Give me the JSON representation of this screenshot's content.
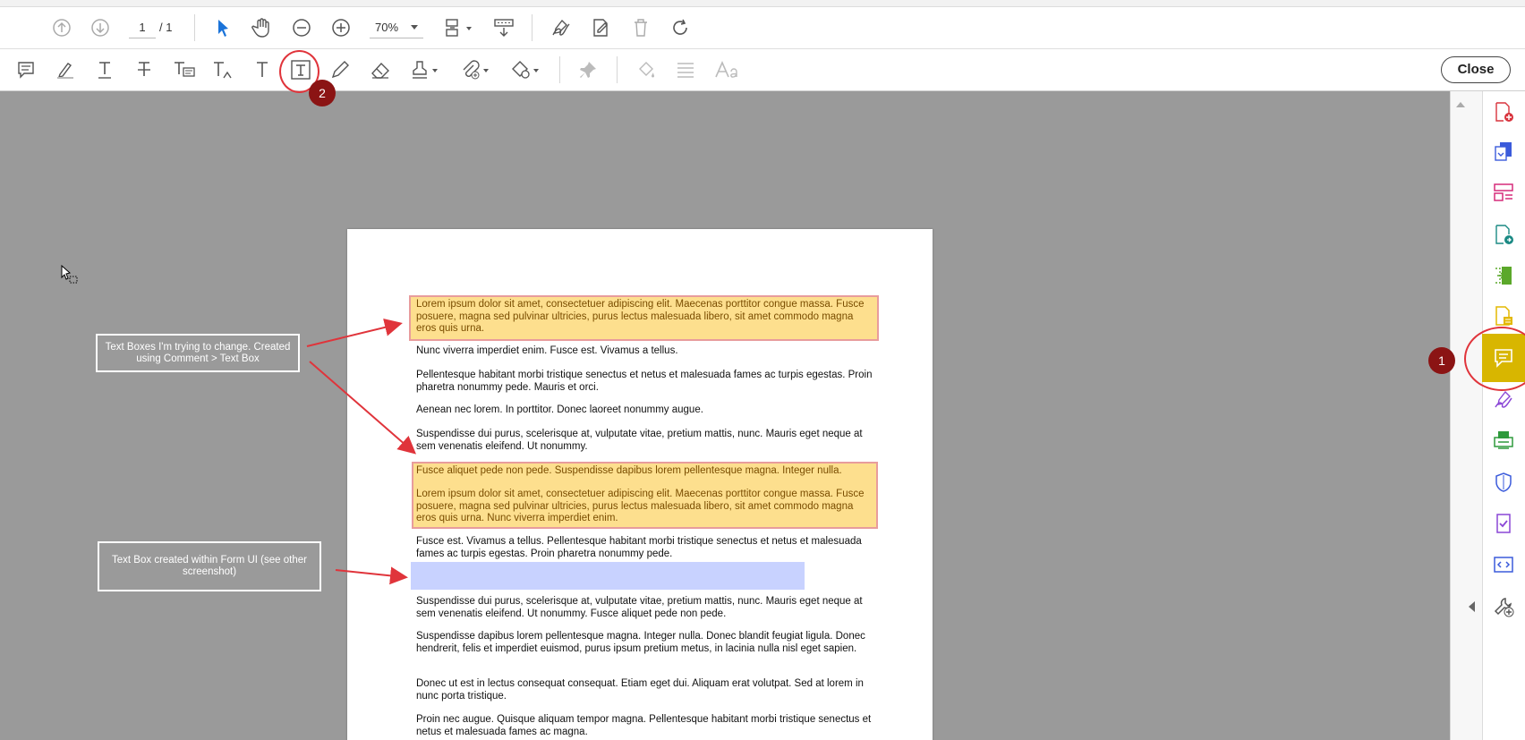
{
  "toolbar": {
    "page_current": "1",
    "page_total": "/ 1",
    "zoom": "70%"
  },
  "close_label": "Close",
  "document": {
    "highlight1": "Lorem ipsum dolor sit amet, consectetuer adipiscing elit. Maecenas porttitor congue massa. Fusce posuere, magna sed pulvinar ultricies, purus lectus malesuada libero, sit amet commodo magna eros quis urna.",
    "para1": "Nunc viverra imperdiet enim. Fusce est. Vivamus a tellus.",
    "para2": "Pellentesque habitant morbi tristique senectus et netus et malesuada fames ac turpis egestas. Proin pharetra nonummy pede. Mauris et orci.",
    "para3": "Aenean nec lorem. In porttitor. Donec laoreet nonummy augue.",
    "para4": "Suspendisse dui purus, scelerisque at, vulputate vitae, pretium mattis, nunc. Mauris eget neque at sem venenatis eleifend. Ut nonummy.",
    "highlight2a": "Fusce aliquet pede non pede. Suspendisse dapibus lorem pellentesque magna. Integer nulla.",
    "highlight2b": "Lorem ipsum dolor sit amet, consectetuer adipiscing elit. Maecenas porttitor congue massa. Fusce posuere, magna sed pulvinar ultricies, purus lectus malesuada libero, sit amet commodo magna eros quis urna. Nunc viverra imperdiet enim.",
    "para5": "Fusce est. Vivamus a tellus. Pellentesque habitant morbi tristique senectus et netus et malesuada fames ac turpis egestas. Proin pharetra nonummy pede.",
    "para6": "Suspendisse dui purus, scelerisque at, vulputate vitae, pretium mattis, nunc. Mauris eget neque at sem venenatis eleifend. Ut nonummy. Fusce aliquet pede non pede.",
    "para7": "Suspendisse dapibus lorem pellentesque magna. Integer nulla. Donec blandit feugiat ligula. Donec hendrerit, felis et imperdiet euismod, purus ipsum pretium metus, in lacinia nulla nisl eget sapien.",
    "para8": "Donec ut est in lectus consequat consequat. Etiam eget dui. Aliquam erat volutpat. Sed at lorem in nunc porta tristique.",
    "para9": "Proin nec augue. Quisque aliquam tempor magna. Pellentesque habitant morbi tristique senectus et netus et malesuada fames ac magna."
  },
  "callouts": {
    "top": "Text Boxes I'm trying to change.  Created using Comment > Text Box",
    "bottom": "Text Box created within Form UI (see other screenshot)"
  },
  "badges": {
    "one": "1",
    "two": "2"
  },
  "right_panel_icons": [
    "create-pdf-icon",
    "export-pdf-icon",
    "organize-pages-icon",
    "edit-pdf-icon",
    "combine-files-icon",
    "create-doc-icon",
    "comment-icon",
    "fill-sign-icon",
    "send-icon",
    "protect-icon",
    "checklist-icon",
    "rich-media-icon",
    "more-tools-icon"
  ],
  "colors": {
    "highlight_fill": "#fddf8e",
    "highlight_border": "#e89c9c",
    "form_field": "#c8d2ff",
    "active_tool": "#d8b600",
    "badge": "#8b1414",
    "annotation_red": "#e0343b"
  }
}
